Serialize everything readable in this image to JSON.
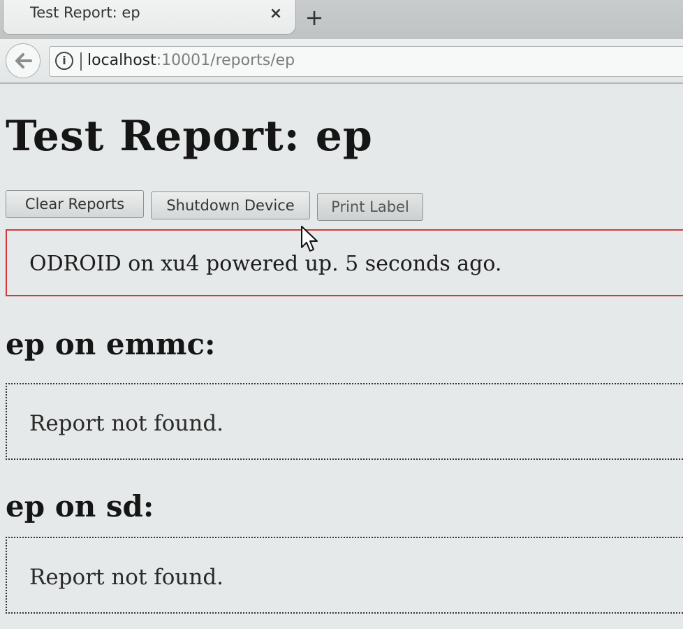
{
  "browser": {
    "tab_title": "Test Report: ep",
    "tab_close": "×",
    "new_tab": "+",
    "url_host": "localhost",
    "url_path": ":10001/reports/ep"
  },
  "page": {
    "title": "Test Report: ep",
    "buttons": {
      "clear": "Clear Reports",
      "shutdown": "Shutdown Device",
      "print": "Print Label"
    },
    "status_message": "ODROID on xu4 powered up. 5 seconds ago.",
    "sections": [
      {
        "heading": "ep on emmc:",
        "report": "Report not found."
      },
      {
        "heading": "ep on sd:",
        "report": "Report not found."
      }
    ]
  },
  "colors": {
    "status_border": "#d23a3a",
    "page_background": "#e6e9e9"
  },
  "icons": [
    "back-arrow-icon",
    "info-icon",
    "close-icon",
    "plus-icon",
    "mouse-cursor-icon"
  ]
}
